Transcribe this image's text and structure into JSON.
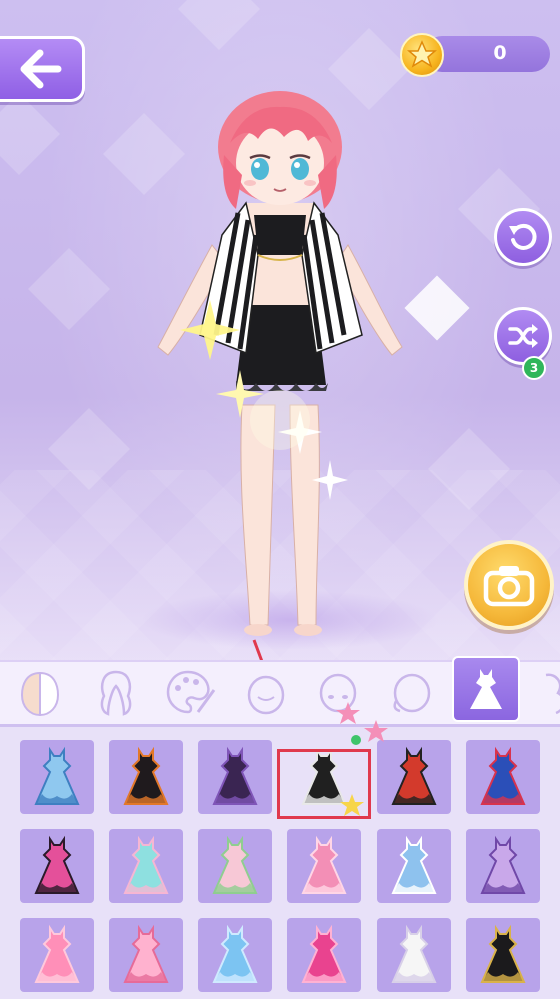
{
  "coins": {
    "value": "0"
  },
  "shuffle": {
    "badge_count": "3"
  },
  "tabs": [
    {
      "name": "tab-skin",
      "icon": "skin-tone-icon"
    },
    {
      "name": "tab-hair",
      "icon": "hair-icon"
    },
    {
      "name": "tab-color",
      "icon": "palette-icon"
    },
    {
      "name": "tab-face",
      "icon": "face-icon"
    },
    {
      "name": "tab-eyes",
      "icon": "head-outline-icon"
    },
    {
      "name": "tab-mouth",
      "icon": "head-blank-icon"
    },
    {
      "name": "tab-outfit",
      "icon": "dress-icon",
      "active": true
    },
    {
      "name": "tab-more",
      "icon": "accessory-icon"
    }
  ],
  "outfits": [
    {
      "name": "blue-gown",
      "colors": [
        "#8fc8ef",
        "#3e7fc1"
      ]
    },
    {
      "name": "pumpkin-halloween-dress",
      "colors": [
        "#1f1a1d",
        "#e2782a"
      ]
    },
    {
      "name": "purple-gothic-dress",
      "colors": [
        "#3a2552",
        "#7f55b8"
      ]
    },
    {
      "name": "striped-jacket-outfit",
      "colors": [
        "#202020",
        "#e8e8e8"
      ],
      "selected": true
    },
    {
      "name": "red-military-jacket",
      "colors": [
        "#d33a2c",
        "#222"
      ]
    },
    {
      "name": "jester-outfit",
      "colors": [
        "#2b4fb8",
        "#d8334d"
      ]
    },
    {
      "name": "pink-black-frilly-dress",
      "colors": [
        "#e4509a",
        "#2a1a2a"
      ]
    },
    {
      "name": "pastel-mint-dress",
      "colors": [
        "#8ee0e0",
        "#f6b6d3"
      ]
    },
    {
      "name": "floral-pink-dress",
      "colors": [
        "#f7c8d6",
        "#8fce90"
      ]
    },
    {
      "name": "pink-ball-gown",
      "colors": [
        "#f38fb6",
        "#ffd6e6"
      ]
    },
    {
      "name": "sailor-uniform",
      "colors": [
        "#8ec2ee",
        "#ffffff"
      ]
    },
    {
      "name": "lilac-star-dress",
      "colors": [
        "#c9a8ea",
        "#7048a8"
      ]
    },
    {
      "name": "pink-princess-dress",
      "colors": [
        "#ff8fb8",
        "#ffc9dc"
      ]
    },
    {
      "name": "bow-pink-dress",
      "colors": [
        "#ffb2cf",
        "#e66b98"
      ]
    },
    {
      "name": "cinderella-blue-gown",
      "colors": [
        "#7cc4f2",
        "#cfeaff"
      ]
    },
    {
      "name": "magenta-gown",
      "colors": [
        "#e9438f",
        "#ffb2d3"
      ]
    },
    {
      "name": "white-lace-gown",
      "colors": [
        "#f6f6f6",
        "#d8d0e8"
      ]
    },
    {
      "name": "black-gold-robe",
      "colors": [
        "#1b1a1c",
        "#d9b24a"
      ]
    }
  ],
  "colors": {
    "accent_purple": "#9a72e6",
    "selection_red": "#e0394d",
    "coin_gold": "#f7b51f",
    "badge_green": "#2fb65a"
  }
}
